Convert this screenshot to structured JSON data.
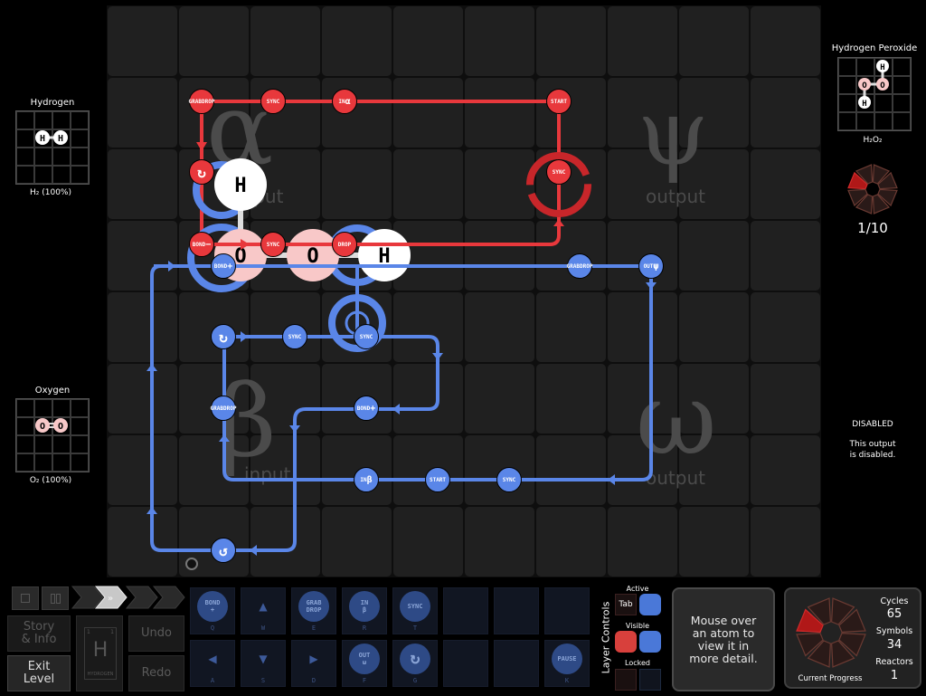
{
  "inputs": [
    {
      "name": "Hydrogen",
      "formula": "H₂ (100%)",
      "atoms": [
        "H",
        "H"
      ],
      "bond": "single",
      "atom_color": "#ffffff"
    },
    {
      "name": "Oxygen",
      "formula": "O₂ (100%)",
      "atoms": [
        "O",
        "O"
      ],
      "bond": "double",
      "atom_color": "#f8c8c8"
    }
  ],
  "outputs": [
    {
      "name": "Hydrogen Peroxide",
      "formula": "H₂O₂",
      "atoms": [
        "H",
        "O",
        "O",
        "H"
      ],
      "progress": "1/10",
      "progress_fraction": 0.1
    },
    {
      "status": "DISABLED",
      "message_line1": "This output",
      "message_line2": "is disabled."
    }
  ],
  "zones": {
    "alpha": {
      "symbol": "α",
      "label": "input"
    },
    "beta": {
      "symbol": "β",
      "label": "input"
    },
    "psi": {
      "symbol": "ψ",
      "label": "output"
    },
    "omega": {
      "symbol": "ω",
      "label": "output"
    }
  },
  "board": {
    "red_waldo": {
      "color": "#e8383c",
      "instructions": [
        {
          "label": "GRAB DROP",
          "type": "grab-drop"
        },
        {
          "label": "SYNC",
          "type": "sync"
        },
        {
          "label": "IN α",
          "type": "input-alpha"
        },
        {
          "label": "START",
          "type": "start"
        },
        {
          "label": "SYNC",
          "type": "sync"
        },
        {
          "label": "↻",
          "type": "rotate"
        },
        {
          "label": "BOND −",
          "type": "bond-minus"
        },
        {
          "label": "SYNC",
          "type": "sync"
        },
        {
          "label": "DROP",
          "type": "drop"
        }
      ]
    },
    "blue_waldo": {
      "color": "#5a86e8",
      "instructions": [
        {
          "label": "BOND +",
          "type": "bond-plus"
        },
        {
          "label": "GRAB DROP",
          "type": "grab-drop"
        },
        {
          "label": "OUT ψ",
          "type": "output-psi"
        },
        {
          "label": "↻",
          "type": "rotate"
        },
        {
          "label": "SYNC",
          "type": "sync"
        },
        {
          "label": "SYNC",
          "type": "sync"
        },
        {
          "label": "GRAB DROP",
          "type": "grab-drop"
        },
        {
          "label": "BOND +",
          "type": "bond-plus"
        },
        {
          "label": "IN β",
          "type": "input-beta"
        },
        {
          "label": "START",
          "type": "start"
        },
        {
          "label": "SYNC",
          "type": "sync"
        },
        {
          "label": "↺",
          "type": "rotate-ccw"
        }
      ]
    },
    "atoms": [
      "H",
      "O",
      "O",
      "H"
    ]
  },
  "controls": {
    "speed_buttons": [
      "stop",
      "pause",
      "step",
      "play",
      "fast",
      "faster"
    ],
    "active_speed": "play",
    "story_label_1": "Story",
    "story_label_2": "& Info",
    "exit_label_1": "Exit",
    "exit_label_2": "Level",
    "undo_label": "Undo",
    "redo_label": "Redo",
    "element": {
      "symbol": "H",
      "number": "1",
      "mass": "1",
      "name": "HYDROGEN"
    }
  },
  "palette": {
    "top_row": [
      {
        "line1": "BOND",
        "line2": "+",
        "key": "Q",
        "kind": "circle"
      },
      {
        "line1": "▲",
        "line2": "",
        "key": "W",
        "kind": "arrow"
      },
      {
        "line1": "GRAB",
        "line2": "DROP",
        "key": "E",
        "kind": "circle"
      },
      {
        "line1": "IN",
        "line2": "β",
        "key": "R",
        "kind": "circle"
      },
      {
        "line1": "SYNC",
        "line2": "",
        "key": "T",
        "kind": "circle"
      }
    ],
    "bottom_row": [
      {
        "line1": "◀",
        "line2": "",
        "key": "A",
        "kind": "arrow"
      },
      {
        "line1": "▼",
        "line2": "",
        "key": "S",
        "kind": "arrow"
      },
      {
        "line1": "▶",
        "line2": "",
        "key": "D",
        "kind": "arrow"
      },
      {
        "line1": "OUT",
        "line2": "ω",
        "key": "F",
        "kind": "circle"
      },
      {
        "line1": "↻",
        "line2": "",
        "key": "G",
        "kind": "circle"
      }
    ],
    "pause": {
      "label": "PAUSE",
      "key": "K"
    }
  },
  "layers": {
    "title": "Layer Controls",
    "active_label": "Active",
    "tab_label": "Tab",
    "visible_label": "Visible",
    "locked_label": "Locked",
    "red": "#d8403c",
    "blue": "#4a78d8"
  },
  "info": {
    "line1": "Mouse over",
    "line2": "an atom to",
    "line3": "view it in",
    "line4": "more detail."
  },
  "stats": {
    "cycles_label": "Cycles",
    "cycles": "65",
    "symbols_label": "Symbols",
    "symbols": "34",
    "reactors_label": "Reactors",
    "reactors": "1",
    "progress_label": "Current Progress",
    "progress_fraction": 0.1
  }
}
